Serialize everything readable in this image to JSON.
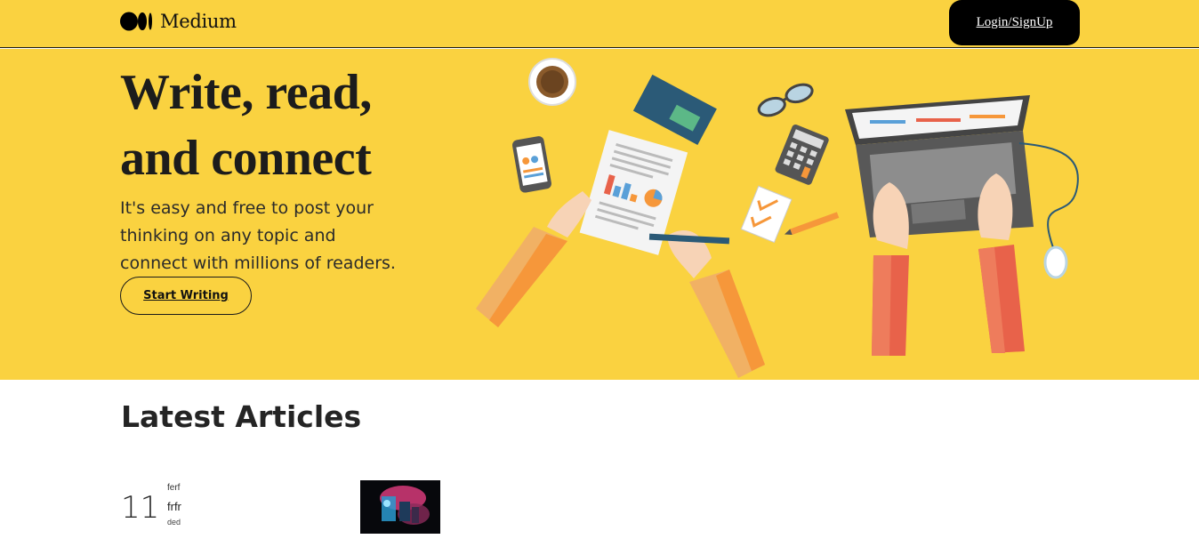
{
  "header": {
    "brand_name": "Medium",
    "login_label": "Login/SignUp",
    "logo_icon": "medium-logo-icon"
  },
  "hero": {
    "title": "Write, read, and connect",
    "subtitle": "It's easy and free to post your thinking on any topic and connect with millions of readers.",
    "cta_label": "Start Writing",
    "background": "#fad240"
  },
  "latest": {
    "heading": "Latest Articles",
    "articles": [
      {
        "number": "11",
        "author": "ferf",
        "title": "frfr",
        "meta": "ded",
        "thumbnail_icon": "article-thumbnail-image"
      }
    ]
  }
}
